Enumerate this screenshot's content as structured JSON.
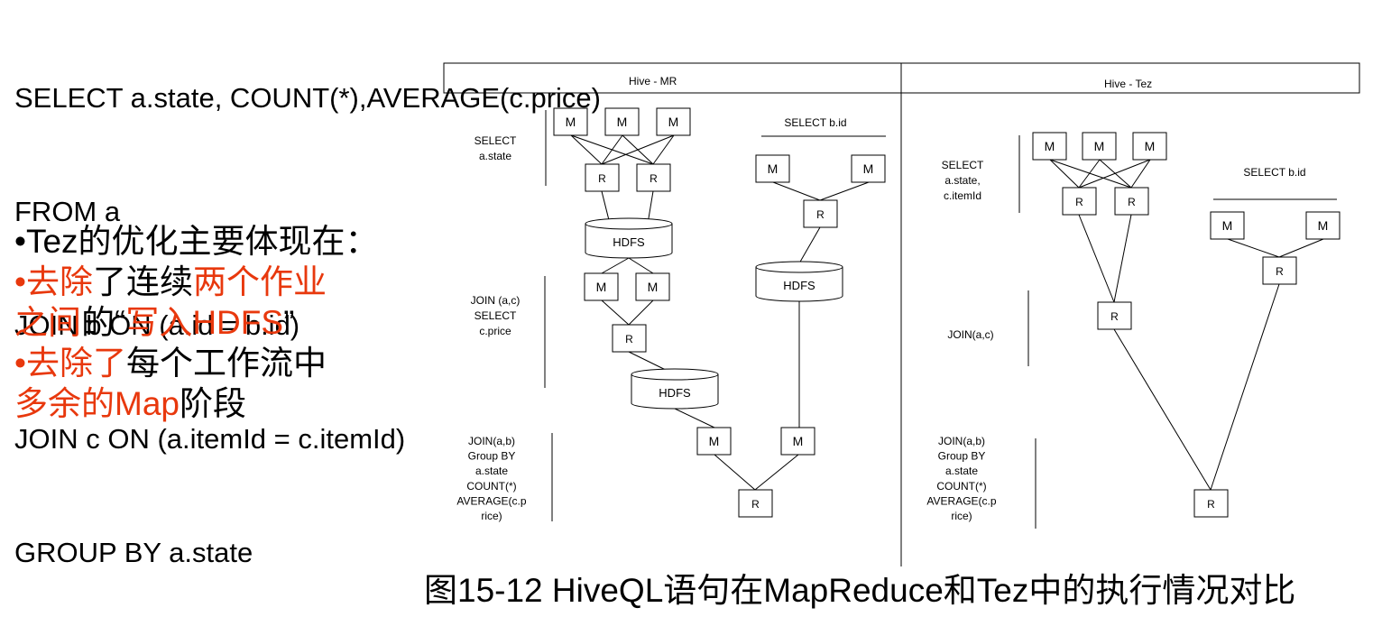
{
  "sql": {
    "lines": [
      "SELECT a.state, COUNT(*),AVERAGE(c.price)",
      "FROM a",
      "JOIN b ON (a.id = b.id)",
      "JOIN c ON (a.itemId = c.itemId)",
      "GROUP BY a.state"
    ]
  },
  "notes": {
    "line1": {
      "bullet": "•",
      "w1": "Tez",
      "w2": "的优化主要体现在："
    },
    "line2": {
      "bullet": "•",
      "w1": "去除",
      "w2": "了连续",
      "w3": "两个作业"
    },
    "line3": {
      "w1": "之间",
      "w2": "的“",
      "w3": "写入HDFS",
      "w4": "”"
    },
    "line4": {
      "bullet": "•",
      "w1": "去除了",
      "w2": "每个工作流中"
    },
    "line5": {
      "w1": "多余的Map",
      "w2": "阶段"
    }
  },
  "diagram": {
    "mr_header": "Hive - MR",
    "tez_header": "Hive - Tez",
    "mr_stage1_label": "SELECT\na.state",
    "mr_stage2_label": "JOIN (a,c)\nSELECT\nc.price",
    "mr_stage3_label": "JOIN(a,b)\nGroup BY\na.state\nCOUNT(*)\nAVERAGE(c.p\nrice)",
    "mr_select_bid": "SELECT b.id",
    "tez_stage1_label": "SELECT\na.state,\nc.itemId",
    "tez_stage2_label": "JOIN(a,c)",
    "tez_stage3_label": "JOIN(a,b)\nGroup BY\na.state\nCOUNT(*)\nAVERAGE(c.p\nrice)",
    "tez_select_bid": "SELECT b.id",
    "map_label": "M",
    "reduce_label": "R",
    "hdfs_label": "HDFS"
  },
  "caption": "图15-12 HiveQL语句在MapReduce和Tez中的执行情况对比"
}
